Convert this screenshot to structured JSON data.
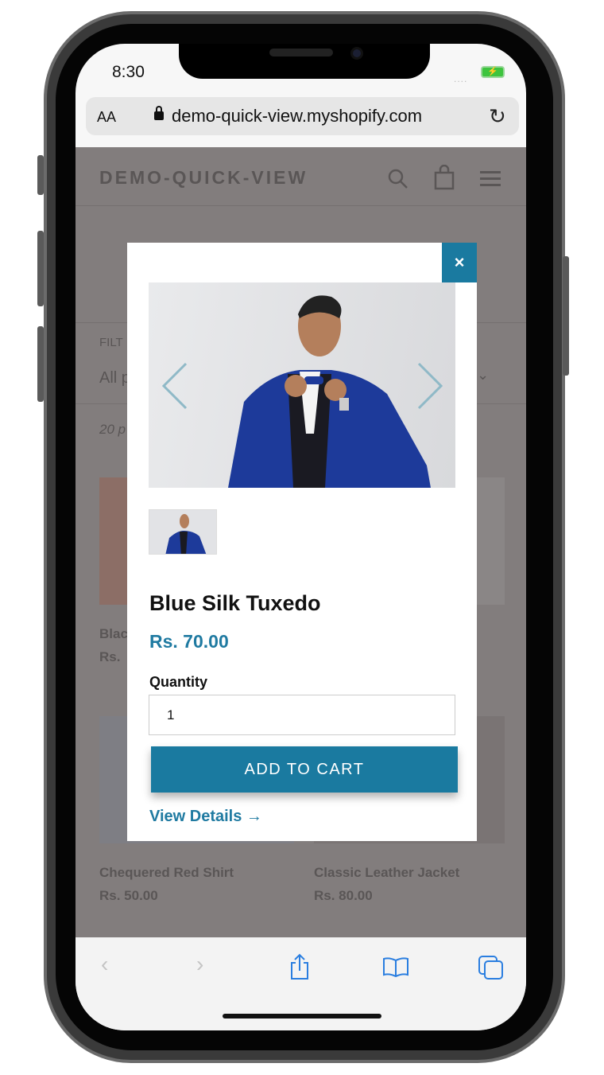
{
  "status_bar": {
    "time": "8:30",
    "signal": "....",
    "battery_icon": "battery-charging-icon"
  },
  "browser": {
    "text_size_label": "AA",
    "url": "demo-quick-view.myshopify.com",
    "lock_icon": "lock-icon",
    "reload_icon": "reload-icon"
  },
  "site": {
    "brand": "DEMO-QUICK-VIEW",
    "icons": [
      "search-icon",
      "bag-icon",
      "menu-icon"
    ],
    "filter_label": "FILT",
    "filter_value": "All p",
    "product_count": "20 p",
    "products": [
      {
        "name": "Blac",
        "price": "Rs."
      },
      {
        "name": "Chequered Red Shirt",
        "price": "Rs. 50.00"
      },
      {
        "name": "Classic Leather Jacket",
        "price": "Rs. 80.00"
      }
    ]
  },
  "quick_view": {
    "close_label": "×",
    "title": "Blue Silk Tuxedo",
    "price": "Rs. 70.00",
    "quantity_label": "Quantity",
    "quantity_value": "1",
    "add_to_cart": "ADD TO CART",
    "view_details": "View Details →",
    "accent_color": "#1a7aa0"
  },
  "toolbar": {
    "icons": [
      "back-icon",
      "forward-icon",
      "share-icon",
      "bookmarks-icon",
      "tabs-icon"
    ]
  }
}
